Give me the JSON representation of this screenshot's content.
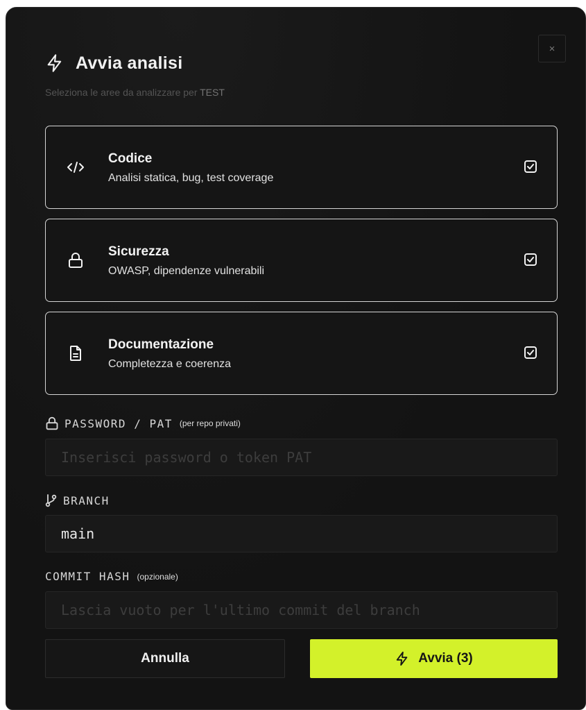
{
  "dialog": {
    "title": "Avvia analisi",
    "subtitle_prefix": "Seleziona le aree da analizzare per ",
    "subtitle_project": "TEST",
    "close_label": "×"
  },
  "areas": [
    {
      "title": "Codice",
      "description": "Analisi statica, bug, test coverage",
      "icon": "code-icon",
      "checked": true
    },
    {
      "title": "Sicurezza",
      "description": "OWASP, dipendenze vulnerabili",
      "icon": "lock-icon",
      "checked": true
    },
    {
      "title": "Documentazione",
      "description": "Completezza e coerenza",
      "icon": "document-icon",
      "checked": true
    }
  ],
  "password": {
    "label": "PASSWORD / PAT",
    "hint": "(per repo privati)",
    "placeholder": "Inserisci password o token PAT",
    "value": ""
  },
  "branch": {
    "label": "BRANCH",
    "value": "main"
  },
  "commit": {
    "label": "COMMIT HASH",
    "hint": "(opzionale)",
    "placeholder": "Lascia vuoto per l'ultimo commit del branch",
    "value": ""
  },
  "actions": {
    "cancel": "Annulla",
    "start": "Avvia (3)"
  },
  "colors": {
    "accent": "#d3f12a",
    "background": "#141414",
    "card_border": "#d6d6d6"
  }
}
